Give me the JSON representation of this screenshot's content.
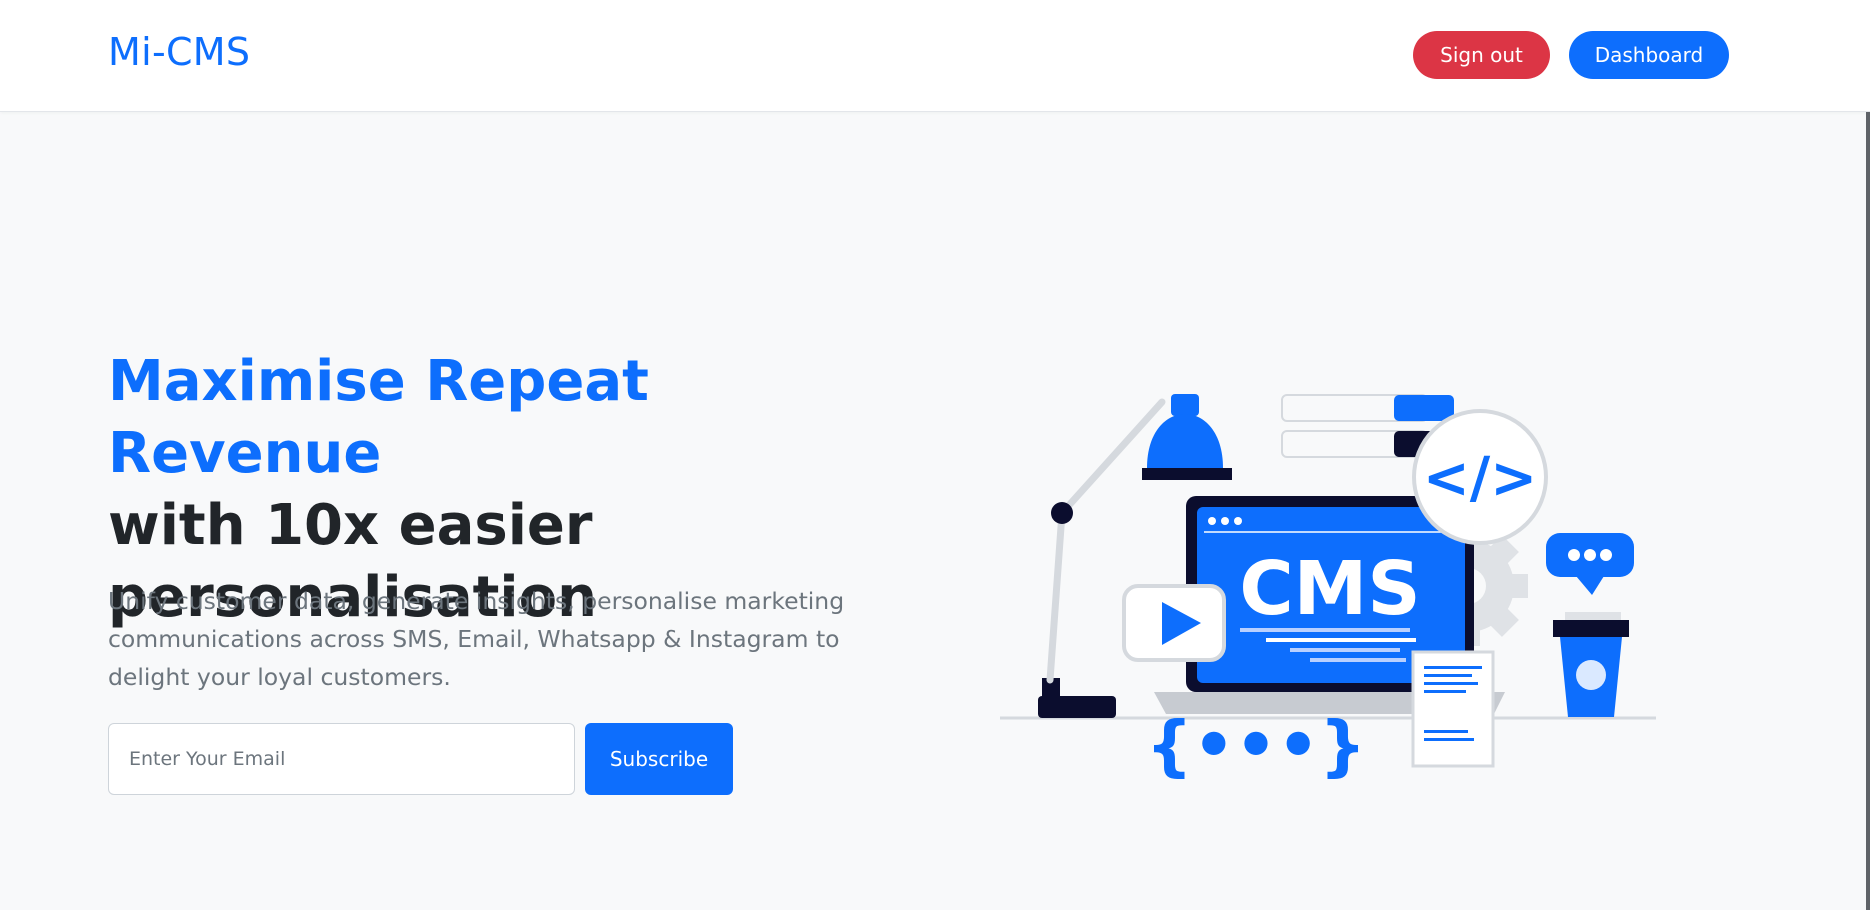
{
  "navbar": {
    "brand": "Mi-CMS",
    "signout_label": "Sign out",
    "dashboard_label": "Dashboard"
  },
  "hero": {
    "title_accent": "Maximise Repeat Revenue",
    "title_rest": "with 10x easier personalisation",
    "subtitle": "Unify customer data, generate insights, personalise marketing communications across SMS, Email, Whatsapp & Instagram to delight your loyal customers."
  },
  "subscribe": {
    "placeholder": "Enter Your Email",
    "button_label": "Subscribe"
  },
  "illustration": {
    "screen_text": "CMS",
    "code_symbol": "</>",
    "braces_text": "{•••}"
  },
  "colors": {
    "primary": "#0d6efd",
    "danger": "#dc3545",
    "dark": "#212529",
    "muted": "#6c757d",
    "navy": "#0b0d2e"
  }
}
